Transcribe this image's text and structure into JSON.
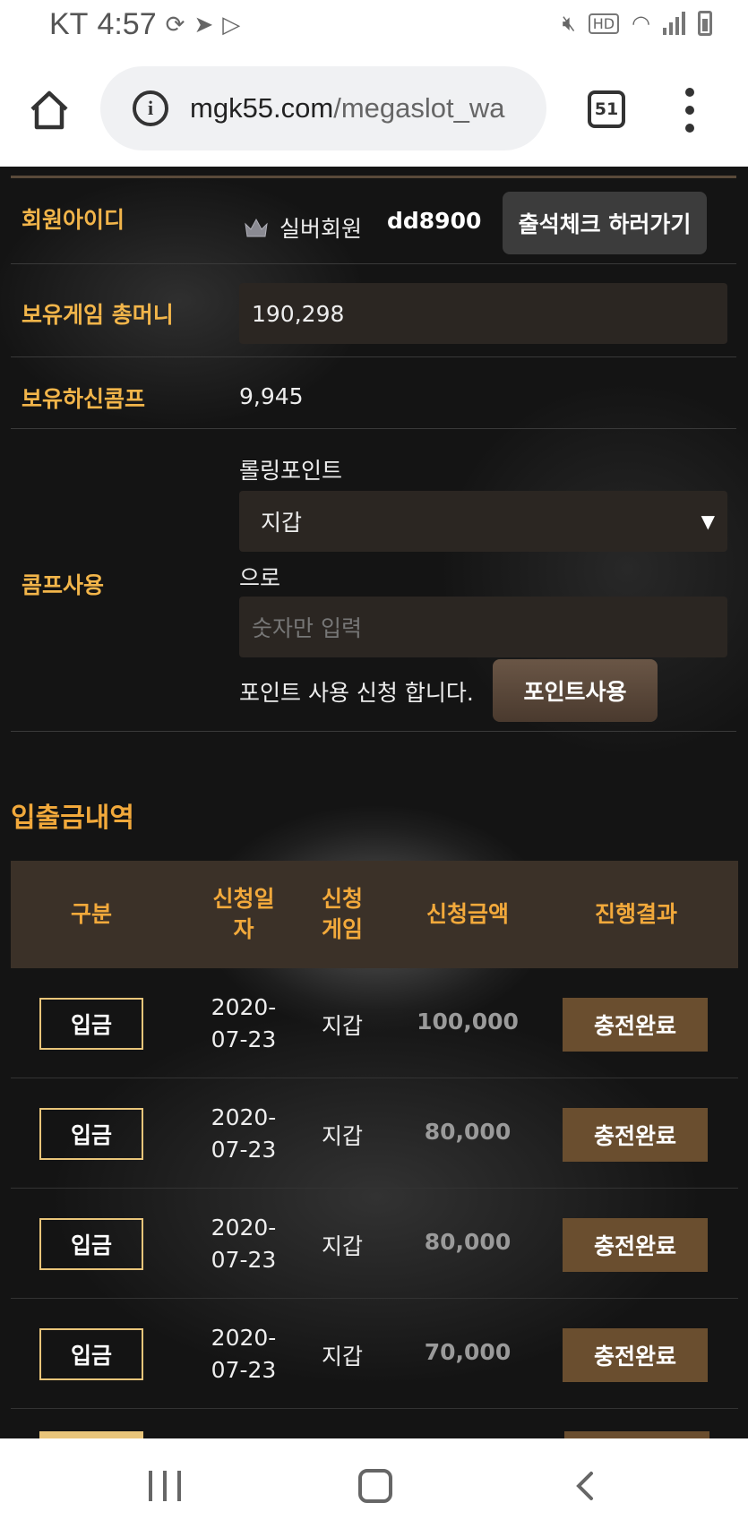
{
  "status_bar": {
    "carrier": "KT",
    "time": "4:57"
  },
  "browser": {
    "url_host": "mgk55.com",
    "url_path": "/megaslot_wa",
    "tab_count": "51"
  },
  "member": {
    "id_label": "회원아이디",
    "grade": "실버회원",
    "user_id": "dd8900",
    "attendance_button": "출석체크 하러가기",
    "money_label": "보유게임 총머니",
    "money_value": "190,298",
    "comp_label": "보유하신콤프",
    "comp_value": "9,945",
    "comp_use_label": "콤프사용",
    "rolling_label": "롤링포인트",
    "wallet_selected": "지갑",
    "to_label": "으로",
    "amount_placeholder": "숫자만 입력",
    "apply_text": "포인트 사용 신청 합니다.",
    "point_button": "포인트사용"
  },
  "history": {
    "title": "입출금내역",
    "columns": {
      "type": "구분",
      "date_l1": "신청일",
      "date_l2": "자",
      "game_l1": "신청",
      "game_l2": "게임",
      "amount": "신청금액",
      "result": "진행결과"
    },
    "rows": [
      {
        "type": "입금",
        "date_l1": "2020-",
        "date_l2": "07-23",
        "game": "지갑",
        "amount": "100,000",
        "result": "충전완료"
      },
      {
        "type": "입금",
        "date_l1": "2020-",
        "date_l2": "07-23",
        "game": "지갑",
        "amount": "80,000",
        "result": "충전완료"
      },
      {
        "type": "입금",
        "date_l1": "2020-",
        "date_l2": "07-23",
        "game": "지갑",
        "amount": "80,000",
        "result": "충전완료"
      },
      {
        "type": "입금",
        "date_l1": "2020-",
        "date_l2": "07-23",
        "game": "지갑",
        "amount": "70,000",
        "result": "충전완료"
      }
    ]
  },
  "colors": {
    "accent_gold": "#f2a93b",
    "label_gold": "#f2b54a",
    "header_bg": "#3b3128",
    "done_badge": "#6a4e2f"
  }
}
